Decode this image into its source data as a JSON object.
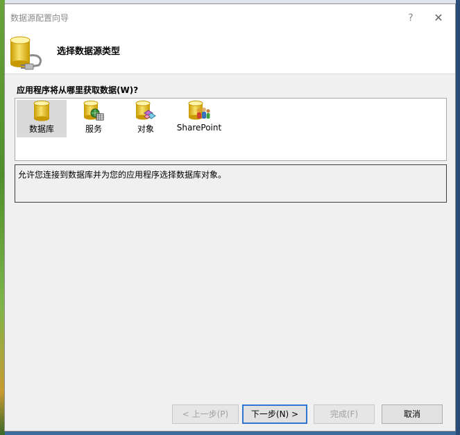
{
  "window": {
    "title": "数据源配置向导",
    "help_glyph": "?",
    "close_glyph": "✕"
  },
  "header": {
    "title": "选择数据源类型",
    "icon": "database-plug-icon"
  },
  "question": "应用程序将从哪里获取数据(W)?",
  "types": [
    {
      "label": "数据库",
      "icon": "database-icon",
      "selected": true
    },
    {
      "label": "服务",
      "icon": "service-icon",
      "selected": false
    },
    {
      "label": "对象",
      "icon": "object-icon",
      "selected": false
    },
    {
      "label": "SharePoint",
      "icon": "sharepoint-icon",
      "selected": false
    }
  ],
  "description": "允许您连接到数据库并为您的应用程序选择数据库对象。",
  "buttons": {
    "prev": "< 上一步(P)",
    "next": "下一步(N) >",
    "finish": "完成(F)",
    "cancel": "取消"
  },
  "colors": {
    "accent": "#2c77d3",
    "db_gold": "#e6b800"
  }
}
